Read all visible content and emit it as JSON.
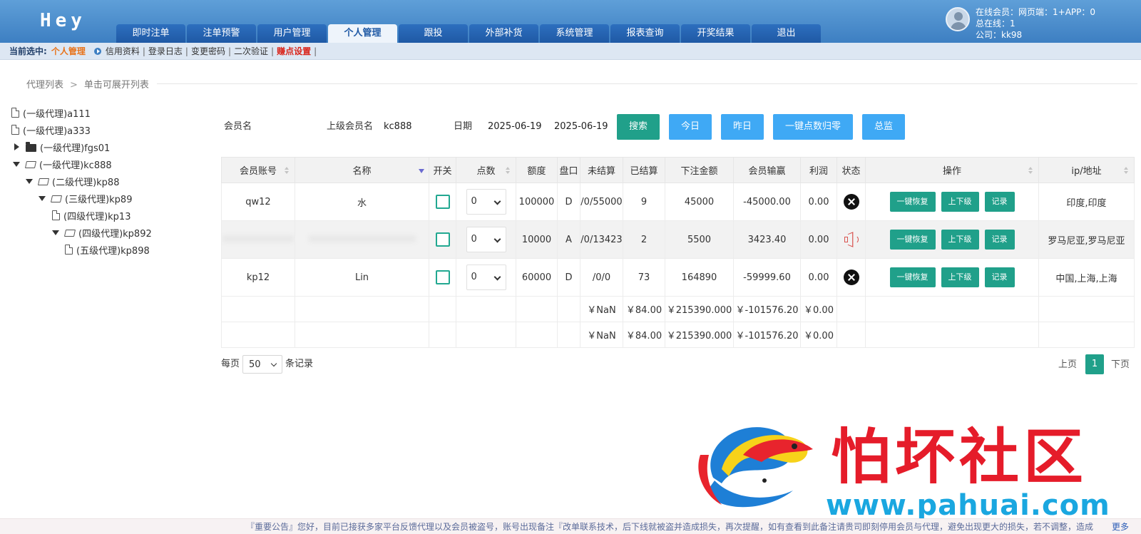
{
  "header": {
    "brand": "Hey",
    "tabs": [
      "即时注单",
      "注单预警",
      "用户管理",
      "个人管理",
      "跟投",
      "外部补货",
      "系统管理",
      "报表查询",
      "开奖结果",
      "退出"
    ],
    "active_tab": "个人管理",
    "online_members": "在线会员：网页端：1+APP：0",
    "total_online": "总在线：1",
    "company": "公司：kk98"
  },
  "subbar": {
    "current_label": "当前选中:",
    "current_value": "个人管理",
    "links": [
      "信用资料",
      "登录日志",
      "变更密码",
      "二次验证"
    ],
    "highlight_link": "赚点设置",
    "separator": "|"
  },
  "breadcrumb": {
    "items": [
      "代理列表",
      "单击可展开列表"
    ],
    "arrow": ">"
  },
  "tree": [
    {
      "label": "(一级代理)a111",
      "icon": "file-icon",
      "caret": ""
    },
    {
      "label": "(一级代理)a333",
      "icon": "file-icon",
      "caret": ""
    },
    {
      "label": "(一级代理)fgs01",
      "icon": "folder-icon",
      "caret": "right"
    },
    {
      "label": "(一级代理)kc888",
      "icon": "folder-open-icon",
      "caret": "down"
    },
    {
      "label": "(二级代理)kp88",
      "icon": "folder-open-icon",
      "caret": "down"
    },
    {
      "label": "(三级代理)kp89",
      "icon": "folder-open-icon",
      "caret": "down"
    },
    {
      "label": "(四级代理)kp13",
      "icon": "file-icon",
      "caret": ""
    },
    {
      "label": "(四级代理)kp892",
      "icon": "folder-open-icon",
      "caret": "down"
    },
    {
      "label": "(五级代理)kp898",
      "icon": "file-icon",
      "caret": ""
    }
  ],
  "filters": {
    "member_label": "会员名",
    "member_value": "",
    "parent_label": "上级会员名",
    "parent_value": "kc888",
    "date_label": "日期",
    "date_from": "2025-06-19",
    "date_to": "2025-06-19",
    "search_btn": "搜索",
    "today_btn": "今日",
    "yesterday_btn": "昨日",
    "reset_btn": "一键点数归零",
    "monitor_btn": "总监"
  },
  "table": {
    "headers": [
      "会员账号",
      "名称",
      "开关",
      "点数",
      "额度",
      "盘口",
      "未结算",
      "已结算",
      "下注金额",
      "会员输赢",
      "利润",
      "状态",
      "操作",
      "ip/地址"
    ],
    "rows": [
      {
        "account": "qw12",
        "name": "水",
        "points": "0",
        "quota": "100000",
        "pan": "D",
        "unsettled": "/0/55000",
        "settled": "9",
        "bet": "45000",
        "winloss": "-45000.00",
        "profit": "0.00",
        "status": "x-icon",
        "ip": "印度,印度"
      },
      {
        "account": "",
        "name": "",
        "points": "0",
        "quota": "10000",
        "pan": "A",
        "unsettled": "/0/13423",
        "settled": "2",
        "bet": "5500",
        "winloss": "3423.40",
        "profit": "0.00",
        "status": "speaker-icon",
        "ip": "罗马尼亚,罗马尼亚"
      },
      {
        "account": "kp12",
        "name": "Lin",
        "points": "0",
        "quota": "60000",
        "pan": "D",
        "unsettled": "/0/0",
        "settled": "73",
        "bet": "164890",
        "winloss": "-59999.60",
        "profit": "0.00",
        "status": "x-icon",
        "ip": "中国,上海,上海"
      }
    ],
    "ops": [
      "一键恢复",
      "上下级",
      "记录"
    ],
    "totals": [
      {
        "unsettled": "￥NaN",
        "settled": "￥84.00",
        "bet": "￥215390.000",
        "winloss": "￥-101576.20",
        "profit": "￥0.00"
      },
      {
        "unsettled": "￥NaN",
        "settled": "￥84.00",
        "bet": "￥215390.000",
        "winloss": "￥-101576.20",
        "profit": "￥0.00"
      }
    ]
  },
  "pager": {
    "per_page_label": "每页",
    "per_page_value": "50",
    "records_label": "条记录",
    "prev": "上页",
    "current": "1",
    "next": "下页"
  },
  "watermark": {
    "title": "怕坏社区",
    "url": "www.pahuai.com"
  },
  "notice": {
    "text": "『重要公告』您好，目前已接获多家平台反馈代理以及会员被盗号，账号出现备注『改单联系技术，后下线就被盗并造成损失，再次提醒，如有查看到此备注请贵司即刻停用会员与代理，避免出现更大的损失，若不调整，造成",
    "more": "更多"
  },
  "colors": {
    "header_blue": "#3d7fc2",
    "green": "#20a08a",
    "light_blue": "#3fa9f5",
    "red": "#d9261c"
  }
}
